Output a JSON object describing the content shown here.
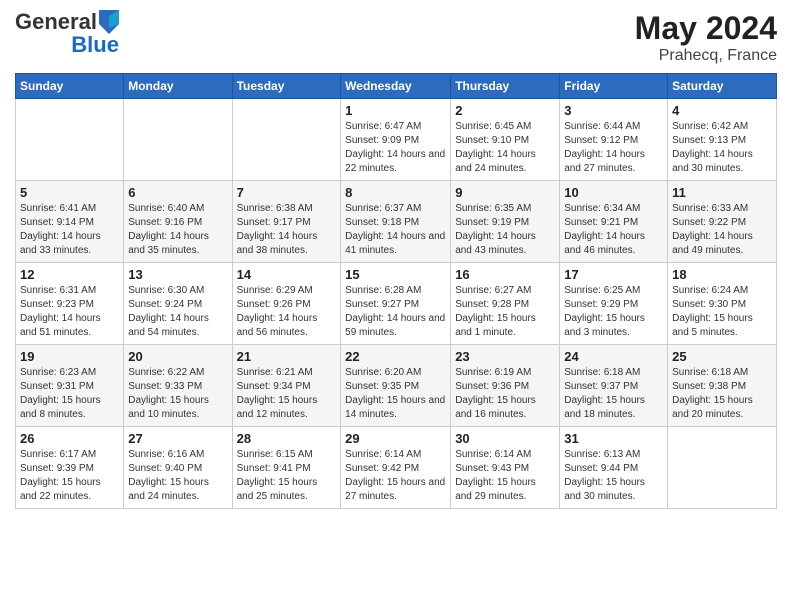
{
  "header": {
    "logo_general": "General",
    "logo_blue": "Blue",
    "month_title": "May 2024",
    "location": "Prahecq, France"
  },
  "weekdays": [
    "Sunday",
    "Monday",
    "Tuesday",
    "Wednesday",
    "Thursday",
    "Friday",
    "Saturday"
  ],
  "weeks": [
    [
      {
        "day": "",
        "info": ""
      },
      {
        "day": "",
        "info": ""
      },
      {
        "day": "",
        "info": ""
      },
      {
        "day": "1",
        "info": "Sunrise: 6:47 AM\nSunset: 9:09 PM\nDaylight: 14 hours and 22 minutes."
      },
      {
        "day": "2",
        "info": "Sunrise: 6:45 AM\nSunset: 9:10 PM\nDaylight: 14 hours and 24 minutes."
      },
      {
        "day": "3",
        "info": "Sunrise: 6:44 AM\nSunset: 9:12 PM\nDaylight: 14 hours and 27 minutes."
      },
      {
        "day": "4",
        "info": "Sunrise: 6:42 AM\nSunset: 9:13 PM\nDaylight: 14 hours and 30 minutes."
      }
    ],
    [
      {
        "day": "5",
        "info": "Sunrise: 6:41 AM\nSunset: 9:14 PM\nDaylight: 14 hours and 33 minutes."
      },
      {
        "day": "6",
        "info": "Sunrise: 6:40 AM\nSunset: 9:16 PM\nDaylight: 14 hours and 35 minutes."
      },
      {
        "day": "7",
        "info": "Sunrise: 6:38 AM\nSunset: 9:17 PM\nDaylight: 14 hours and 38 minutes."
      },
      {
        "day": "8",
        "info": "Sunrise: 6:37 AM\nSunset: 9:18 PM\nDaylight: 14 hours and 41 minutes."
      },
      {
        "day": "9",
        "info": "Sunrise: 6:35 AM\nSunset: 9:19 PM\nDaylight: 14 hours and 43 minutes."
      },
      {
        "day": "10",
        "info": "Sunrise: 6:34 AM\nSunset: 9:21 PM\nDaylight: 14 hours and 46 minutes."
      },
      {
        "day": "11",
        "info": "Sunrise: 6:33 AM\nSunset: 9:22 PM\nDaylight: 14 hours and 49 minutes."
      }
    ],
    [
      {
        "day": "12",
        "info": "Sunrise: 6:31 AM\nSunset: 9:23 PM\nDaylight: 14 hours and 51 minutes."
      },
      {
        "day": "13",
        "info": "Sunrise: 6:30 AM\nSunset: 9:24 PM\nDaylight: 14 hours and 54 minutes."
      },
      {
        "day": "14",
        "info": "Sunrise: 6:29 AM\nSunset: 9:26 PM\nDaylight: 14 hours and 56 minutes."
      },
      {
        "day": "15",
        "info": "Sunrise: 6:28 AM\nSunset: 9:27 PM\nDaylight: 14 hours and 59 minutes."
      },
      {
        "day": "16",
        "info": "Sunrise: 6:27 AM\nSunset: 9:28 PM\nDaylight: 15 hours and 1 minute."
      },
      {
        "day": "17",
        "info": "Sunrise: 6:25 AM\nSunset: 9:29 PM\nDaylight: 15 hours and 3 minutes."
      },
      {
        "day": "18",
        "info": "Sunrise: 6:24 AM\nSunset: 9:30 PM\nDaylight: 15 hours and 5 minutes."
      }
    ],
    [
      {
        "day": "19",
        "info": "Sunrise: 6:23 AM\nSunset: 9:31 PM\nDaylight: 15 hours and 8 minutes."
      },
      {
        "day": "20",
        "info": "Sunrise: 6:22 AM\nSunset: 9:33 PM\nDaylight: 15 hours and 10 minutes."
      },
      {
        "day": "21",
        "info": "Sunrise: 6:21 AM\nSunset: 9:34 PM\nDaylight: 15 hours and 12 minutes."
      },
      {
        "day": "22",
        "info": "Sunrise: 6:20 AM\nSunset: 9:35 PM\nDaylight: 15 hours and 14 minutes."
      },
      {
        "day": "23",
        "info": "Sunrise: 6:19 AM\nSunset: 9:36 PM\nDaylight: 15 hours and 16 minutes."
      },
      {
        "day": "24",
        "info": "Sunrise: 6:18 AM\nSunset: 9:37 PM\nDaylight: 15 hours and 18 minutes."
      },
      {
        "day": "25",
        "info": "Sunrise: 6:18 AM\nSunset: 9:38 PM\nDaylight: 15 hours and 20 minutes."
      }
    ],
    [
      {
        "day": "26",
        "info": "Sunrise: 6:17 AM\nSunset: 9:39 PM\nDaylight: 15 hours and 22 minutes."
      },
      {
        "day": "27",
        "info": "Sunrise: 6:16 AM\nSunset: 9:40 PM\nDaylight: 15 hours and 24 minutes."
      },
      {
        "day": "28",
        "info": "Sunrise: 6:15 AM\nSunset: 9:41 PM\nDaylight: 15 hours and 25 minutes."
      },
      {
        "day": "29",
        "info": "Sunrise: 6:14 AM\nSunset: 9:42 PM\nDaylight: 15 hours and 27 minutes."
      },
      {
        "day": "30",
        "info": "Sunrise: 6:14 AM\nSunset: 9:43 PM\nDaylight: 15 hours and 29 minutes."
      },
      {
        "day": "31",
        "info": "Sunrise: 6:13 AM\nSunset: 9:44 PM\nDaylight: 15 hours and 30 minutes."
      },
      {
        "day": "",
        "info": ""
      }
    ]
  ]
}
